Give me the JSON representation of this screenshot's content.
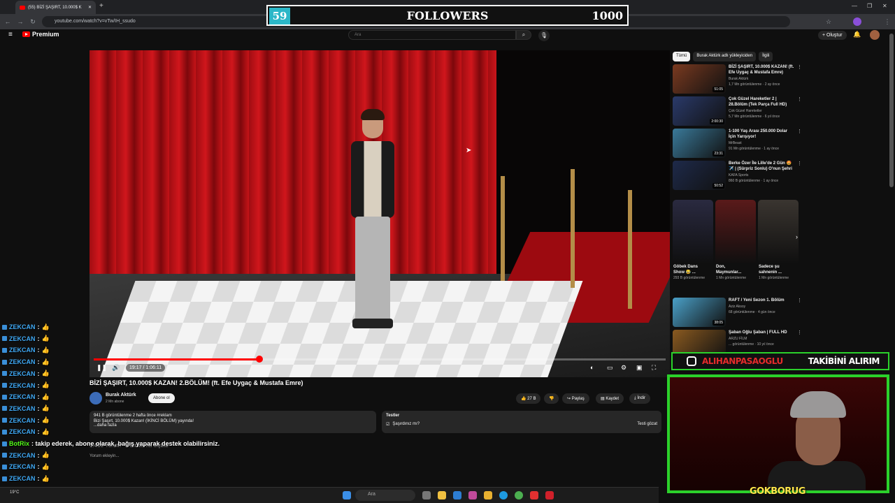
{
  "browser": {
    "tab_title": "(55) BİZİ ŞAŞIRT, 10.000$ K",
    "new_tab": "+",
    "url": "youtube.com/watch?v=vTw/IH_ssudo"
  },
  "youtube_header": {
    "logo": "Premium",
    "search_placeholder": "Ara",
    "create_label": "+ Oluştur"
  },
  "overlay": {
    "followers_count": "59",
    "followers_title": "FOLLOWERS",
    "followers_goal": "1000",
    "instagram_handle": "ALIHANPASAOGLU",
    "follow_text": "TAKİBİNİ ALIRIM",
    "streamer_name": "GOKBORUG"
  },
  "player": {
    "time": "19:17 / 1:06:11",
    "progress_fraction": 0.29
  },
  "video": {
    "title": "BİZİ ŞAŞIRT, 10.000$ KAZAN! 2.BÖLÜM! (ft. Efe Uygaç & Mustafa Emre)",
    "channel": "Burak Aktürk",
    "subs": "2 Mn abone",
    "subscribe": "Abone ol",
    "likes": "27 B",
    "share": "Paylaş",
    "save": "Kaydet",
    "download": "İndir",
    "desc_stats": "941 B görüntülenme  2 hafta önce  #reklam",
    "desc_line": "Bizi Şaşırt, 10.000$ Kazan! (İKİNCİ BÖLÜM) yayında!",
    "desc_more": "...daha fazla",
    "tests_title": "Testler",
    "tests_question": "Şaşırdınız mı?",
    "tests_button": "Testi gözat",
    "comment_count": "1.408 Yorum",
    "sort": "Sıralama ölçütü",
    "add_comment": "Yorum ekleyin..."
  },
  "sidebar": {
    "chips": [
      "Tümü",
      "Burak Aktürk adlı yükleyiciden",
      "İlgili"
    ],
    "recs": [
      {
        "title": "BİZİ ŞAŞIRT, 10.000$ KAZAN! (ft. Efe Uygaç & Mustafa Emre)",
        "channel": "Burak Aktürk",
        "views": "1,7 Mn görüntülenme · 2 ay önce",
        "duration": "51:05",
        "color": "#7a3a20"
      },
      {
        "title": "Çok Güzel Hareketler 2 | 28.Bölüm (Tek Parça Full HD)",
        "channel": "Çok Güzel Hareketler",
        "views": "5,7 Mn görüntülenme · 6 yıl önce",
        "duration": "2:00:30",
        "color": "#2a3a6a"
      },
      {
        "title": "1-100 Yaş Arası 250.000 Dolar İçin Yarışıyor!",
        "channel": "MrBeast",
        "views": "91 Mn görüntülenme · 1 ay önce",
        "duration": "23:31",
        "color": "#3a7a9a"
      },
      {
        "title": "Berke Özer İle Lille'de 2 Gün 🤩✈️ | (Sürpriz Sonlu) O'nun Şehri",
        "channel": "KAFA Sports",
        "views": "860 B görüntülenme · 1 ay önce",
        "duration": "50:52",
        "color": "#1e2a4a"
      }
    ],
    "shorts": [
      {
        "title": "Göbek Dans Show 😂 ...",
        "views": "293 B görüntülenme",
        "color": "#2a2a40"
      },
      {
        "title": "Don, Maymunlar...",
        "views": "1 Mn görüntülenme",
        "color": "#5a1a1a"
      },
      {
        "title": "Sadece şu sahnenin ...",
        "views": "1 Mn görüntülenme",
        "color": "#3a3530"
      }
    ],
    "recs2": [
      {
        "title": "RAFT / Yeni Sezon 1. Bölüm",
        "channel": "Aziz Aksoy",
        "views": "68 görüntülenme · 4 gün önce",
        "duration": "38:05",
        "color": "#4aa0c8"
      },
      {
        "title": "Şaban Oğlu Şaban | FULL HD",
        "channel": "ARZU FİLM",
        "views": "... görüntülenme · 10 yıl önce",
        "duration": "",
        "color": "#8a5a20"
      }
    ]
  },
  "chat": {
    "lines": [
      {
        "user": "ZEKCAN",
        "msg": ":",
        "emote": "👍"
      },
      {
        "user": "ZEKCAN",
        "msg": ":",
        "emote": "👍"
      },
      {
        "user": "ZEKCAN",
        "msg": ":",
        "emote": "👍"
      },
      {
        "user": "ZEKCAN",
        "msg": ":",
        "emote": "👍"
      },
      {
        "user": "ZEKCAN",
        "msg": ":",
        "emote": "👍"
      },
      {
        "user": "ZEKCAN",
        "msg": ":",
        "emote": "👍"
      },
      {
        "user": "ZEKCAN",
        "msg": ":",
        "emote": "👍"
      },
      {
        "user": "ZEKCAN",
        "msg": ":",
        "emote": "👍"
      },
      {
        "user": "ZEKCAN",
        "msg": ":",
        "emote": "👍"
      },
      {
        "user": "ZEKCAN",
        "msg": ":",
        "emote": "👍"
      },
      {
        "user": "BotRix",
        "msg": ": takip ederek, abone olarak, bağış yaparak destek olabilirsiniz.",
        "emote": ""
      },
      {
        "user": "ZEKCAN",
        "msg": ":",
        "emote": "👍"
      },
      {
        "user": "ZEKCAN",
        "msg": ":",
        "emote": "👍"
      },
      {
        "user": "ZEKCAN",
        "msg": ":",
        "emote": "👍"
      }
    ]
  },
  "taskbar": {
    "search": "Ara",
    "weather": "19°C"
  }
}
